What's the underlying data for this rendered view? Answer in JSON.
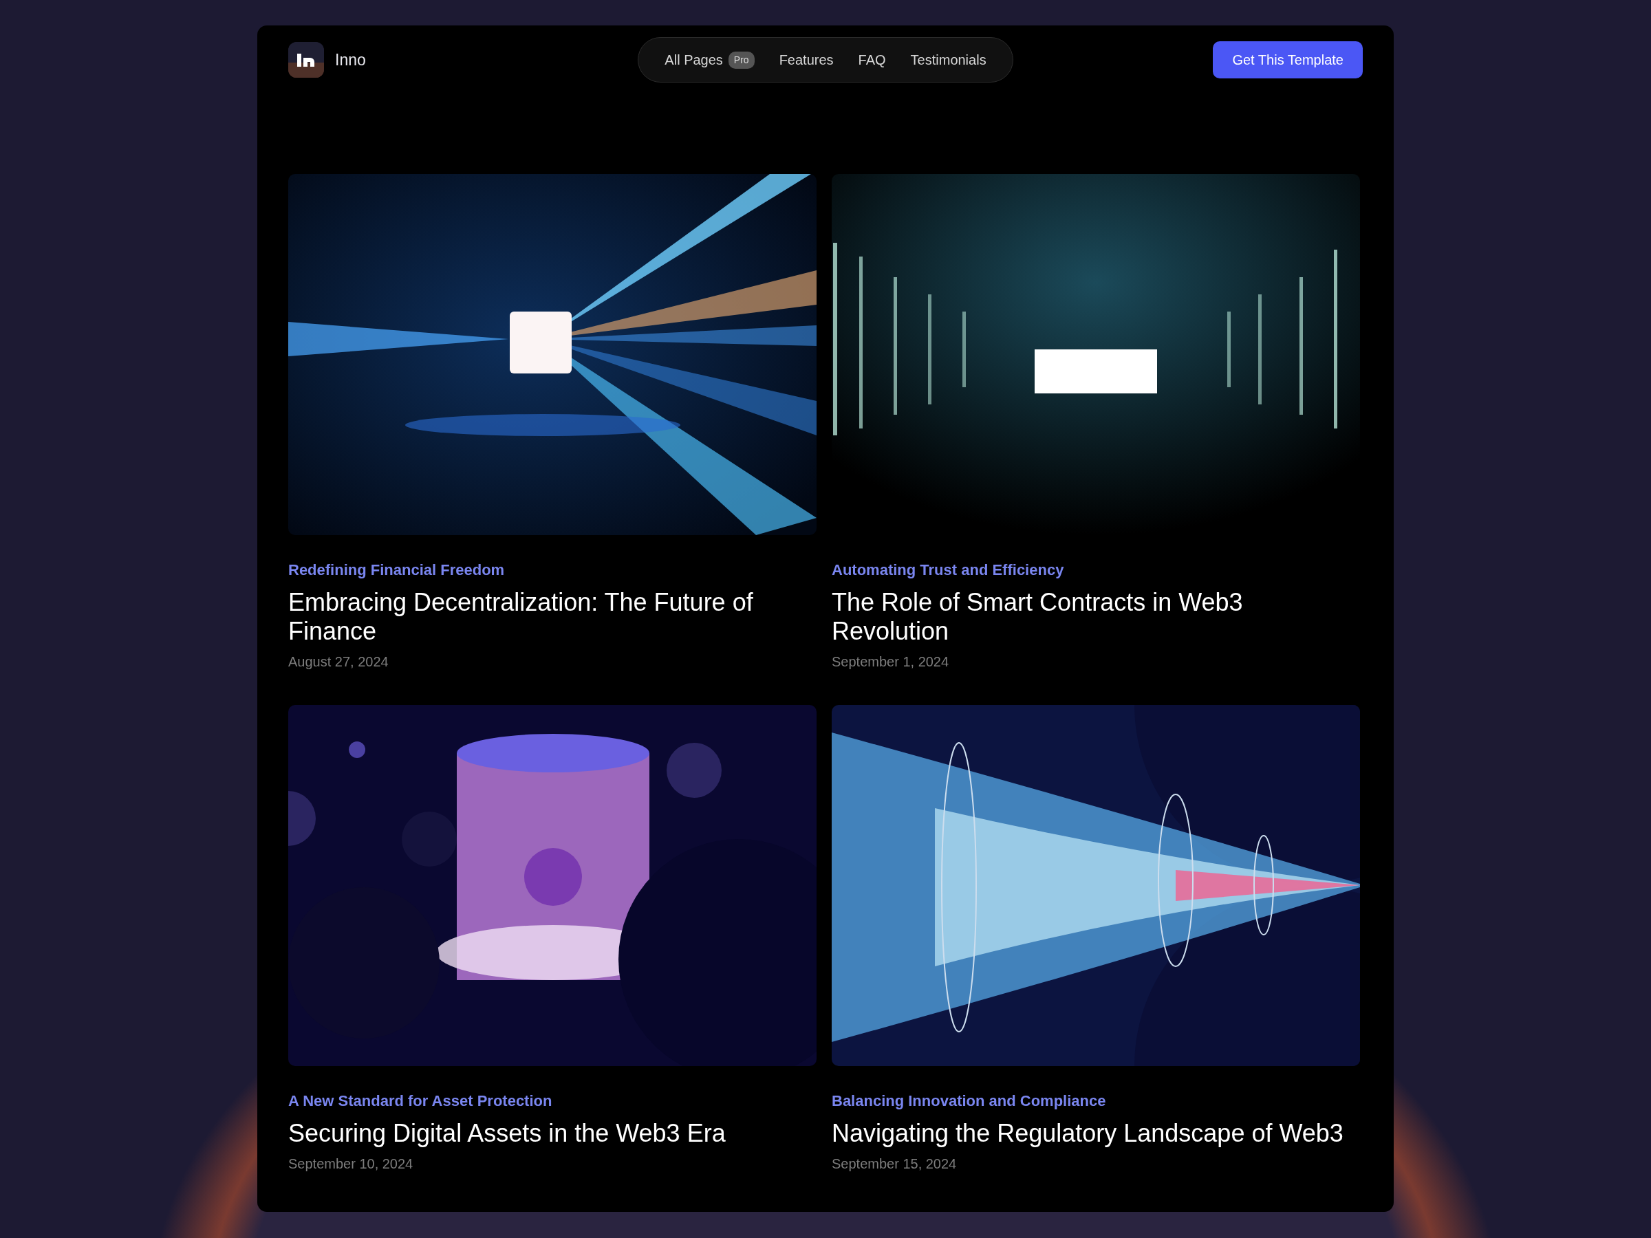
{
  "brand": {
    "name": "Inno"
  },
  "nav": {
    "items": [
      {
        "label": "All Pages",
        "badge": "Pro"
      },
      {
        "label": "Features"
      },
      {
        "label": "FAQ"
      },
      {
        "label": "Testimonials"
      }
    ]
  },
  "cta": {
    "label": "Get This Template"
  },
  "posts": [
    {
      "category": "Redefining Financial Freedom",
      "title": "Embracing Decentralization: The Future of Finance",
      "date": "August 27, 2024"
    },
    {
      "category": "Automating Trust and Efficiency",
      "title": "The Role of Smart Contracts in Web3 Revolution",
      "date": "September 1, 2024"
    },
    {
      "category": "A New Standard for Asset Protection",
      "title": "Securing Digital Assets in the Web3 Era",
      "date": "September 10, 2024"
    },
    {
      "category": "Balancing Innovation and Compliance",
      "title": "Navigating the Regulatory Landscape of Web3",
      "date": "September 15, 2024"
    }
  ]
}
